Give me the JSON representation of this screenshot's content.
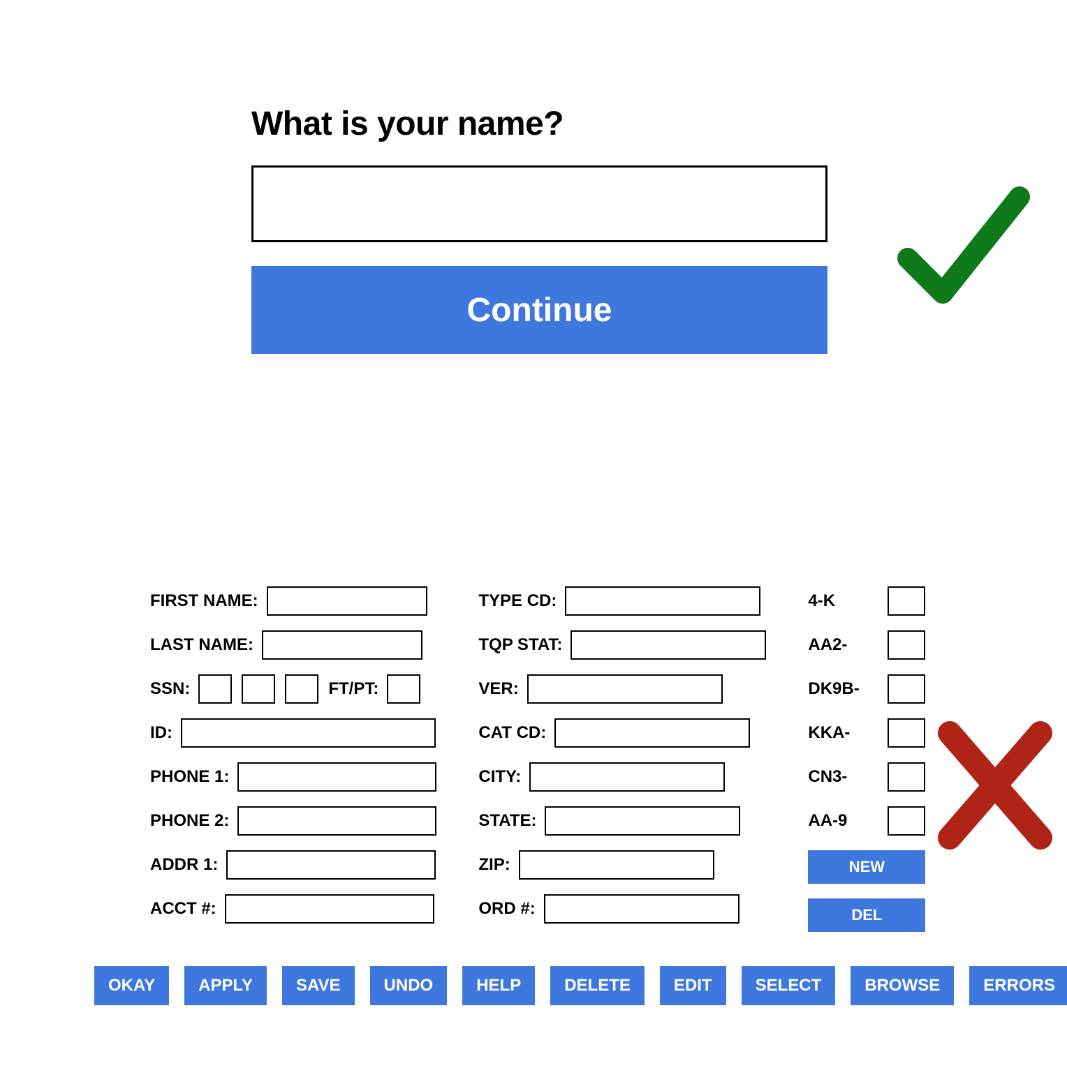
{
  "good": {
    "title": "What is your name?",
    "continue": "Continue"
  },
  "bad": {
    "col1": {
      "first_name": "FIRST NAME:",
      "last_name": "LAST NAME:",
      "ssn": "SSN:",
      "ftpt": "FT/PT:",
      "id": "ID:",
      "phone1": "PHONE 1:",
      "phone2": "PHONE 2:",
      "addr1": "ADDR 1:",
      "acct": "ACCT #:"
    },
    "col2": {
      "type_cd": "TYPE CD:",
      "tqp_stat": "TQP STAT:",
      "ver": "VER:",
      "cat_cd": "CAT CD:",
      "city": "CITY:",
      "state": "STATE:",
      "zip": "ZIP:",
      "ord": "ORD #:"
    },
    "col3": {
      "codes": [
        "4-K",
        "AA2-",
        "DK9B-",
        "KKA-",
        "CN3-",
        "AA-9"
      ],
      "new_btn": "NEW",
      "del_btn": "DEL"
    },
    "buttons": [
      "OKAY",
      "APPLY",
      "SAVE",
      "UNDO",
      "HELP",
      "DELETE",
      "EDIT",
      "SELECT",
      "BROWSE",
      "ERRORS"
    ]
  }
}
